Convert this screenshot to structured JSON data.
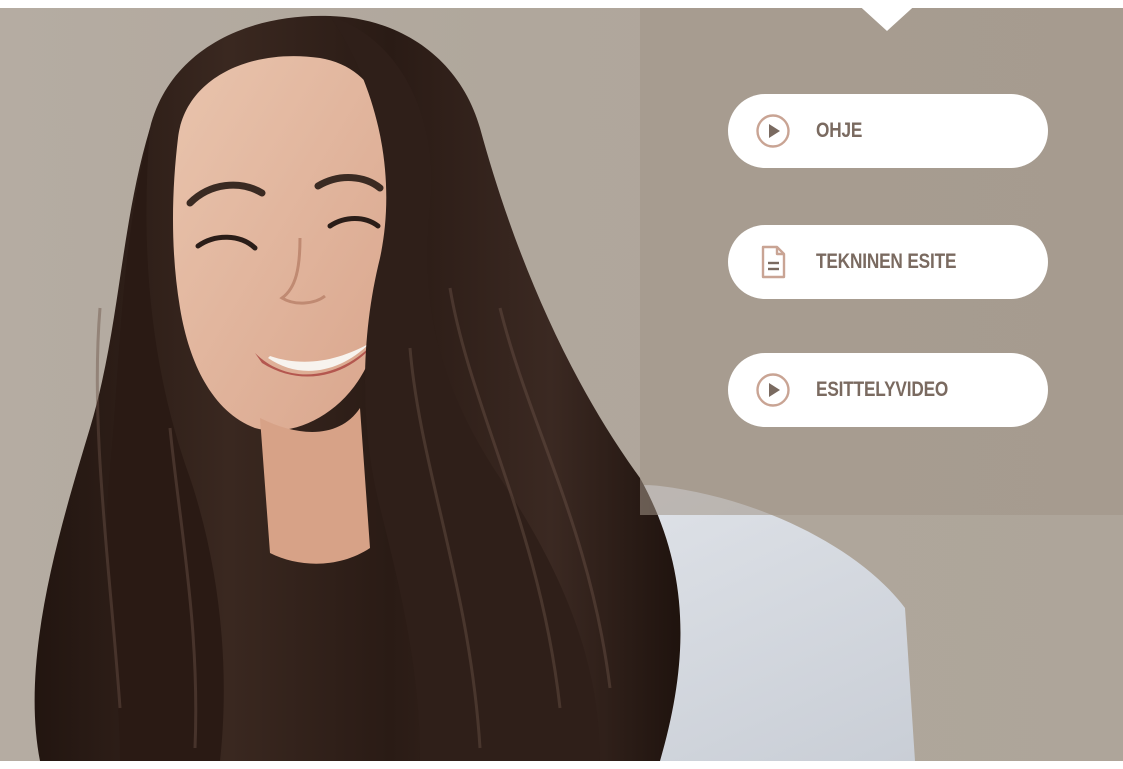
{
  "buttons": {
    "guide": {
      "label": "OHJE",
      "icon": "play-circle-icon"
    },
    "technical_brochure": {
      "label": "TEKNINEN ESITE",
      "icon": "document-icon"
    },
    "presentation_video": {
      "label": "ESITTELYVIDEO",
      "icon": "play-circle-icon"
    }
  },
  "colors": {
    "background": "#b1a89d",
    "panel": "#a59a8e",
    "button": "#ffffff",
    "button_text": "#7a6a60",
    "icon_accent": "#c9a494",
    "hair": "#2b1d17"
  }
}
